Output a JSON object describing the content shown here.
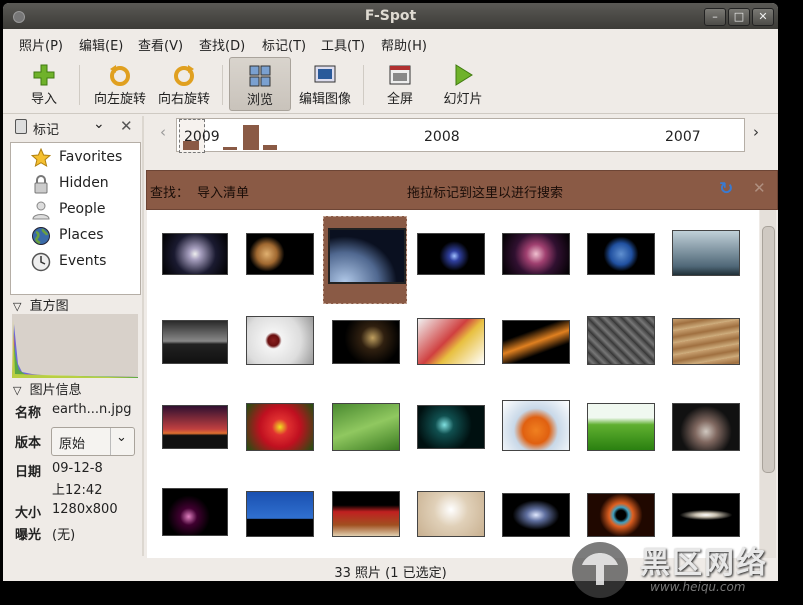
{
  "window": {
    "title": "F-Spot"
  },
  "menu": [
    "照片(P)",
    "编辑(E)",
    "查看(V)",
    "查找(D)",
    "标记(T)",
    "工具(T)",
    "帮助(H)"
  ],
  "toolbar": {
    "import": "导入",
    "rotate_left": "向左旋转",
    "rotate_right": "向右旋转",
    "browse": "浏览",
    "edit_image": "编辑图像",
    "fullscreen": "全屏",
    "slideshow": "幻灯片"
  },
  "sidebar": {
    "combo_label": "标记",
    "tags": [
      "Favorites",
      "Hidden",
      "People",
      "Places",
      "Events"
    ],
    "histogram_title": "直方图",
    "info_title": "图片信息"
  },
  "info": {
    "name_label": "名称",
    "name_value": "earth...n.jpg",
    "version_label": "版本",
    "version_value": "原始",
    "date_label": "日期",
    "date_value": "09-12-8",
    "time_value": "上12:42",
    "size_label": "大小",
    "size_value": "1280x800",
    "exposure_label": "曝光",
    "exposure_value": "(无)"
  },
  "timeline": {
    "years": [
      "2009",
      "2008",
      "2007"
    ]
  },
  "find": {
    "label": "查找：",
    "query": "导入清单",
    "hint": "拖拉标记到这里以进行搜索"
  },
  "status": "33 照片 (1 已选定)",
  "watermark": {
    "cn": "黑区网络",
    "url": "www.heiqu.com"
  }
}
